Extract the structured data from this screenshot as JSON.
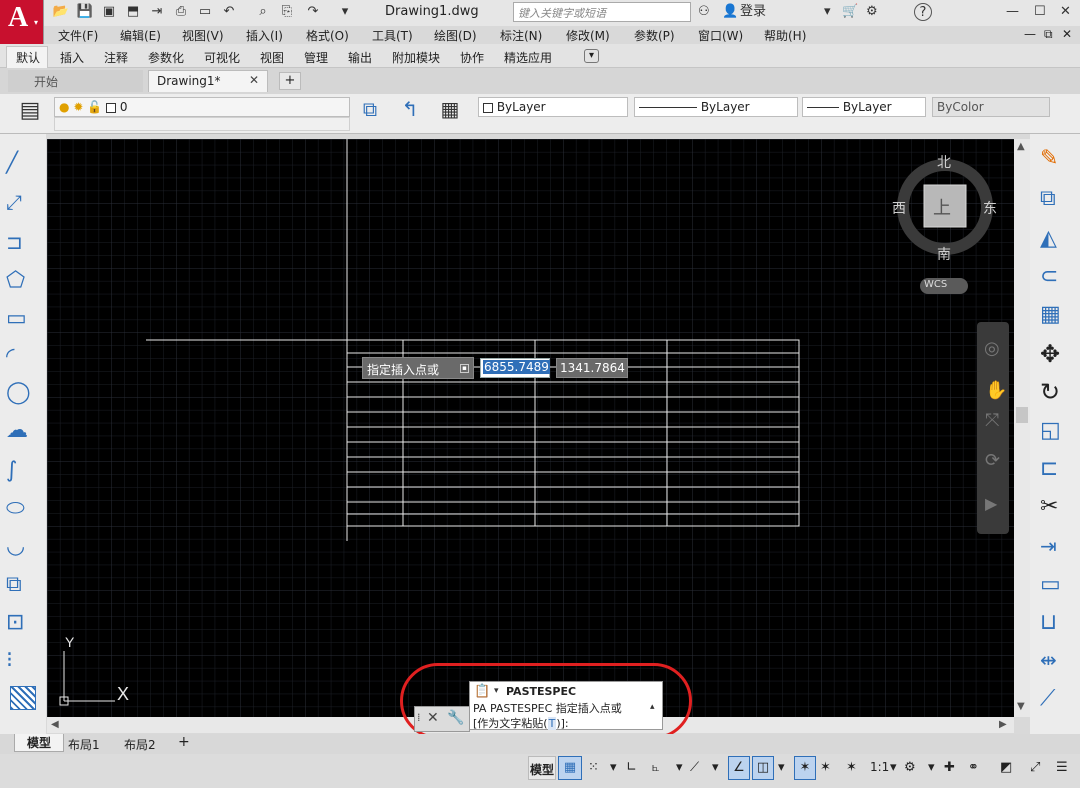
{
  "app": {
    "logo_letter": "A",
    "logo_sub": "▾",
    "title": "Drawing1.dwg"
  },
  "titlebar": {
    "search_placeholder": "键入关键字或短语",
    "login_label": "登录",
    "help_label": "?",
    "min_label": "—",
    "max_label": "☐",
    "close_label": "✕"
  },
  "menubar": {
    "items": [
      "文件(F)",
      "编辑(E)",
      "视图(V)",
      "插入(I)",
      "格式(O)",
      "工具(T)",
      "绘图(D)",
      "标注(N)",
      "修改(M)",
      "参数(P)",
      "窗口(W)",
      "帮助(H)"
    ],
    "win_min": "—",
    "win_restore": "⧉",
    "win_close": "✕"
  },
  "ribbon": {
    "tabs": [
      "默认",
      "插入",
      "注释",
      "参数化",
      "可视化",
      "视图",
      "管理",
      "输出",
      "附加模块",
      "协作",
      "精选应用"
    ]
  },
  "filetabs": {
    "start": "开始",
    "drawing": "Drawing1*",
    "close": "✕",
    "add": "+"
  },
  "properties": {
    "layer_value": "0",
    "color_value": "ByLayer",
    "linetype_value": "ByLayer",
    "lineweight_value": "ByLayer",
    "plotstyle_value": "ByColor"
  },
  "canvas": {
    "tooltip_label": "指定插入点或",
    "coord_x": "6855.7489",
    "coord_y": "1341.7864",
    "ucs_x": "X",
    "ucs_y": "Y"
  },
  "navcube": {
    "north": "北",
    "south": "南",
    "east": "东",
    "west": "西",
    "top": "上",
    "wcs": "WCS"
  },
  "command": {
    "cmd_name": "PASTESPEC",
    "line1": "PA  PASTESPEC 指定插入点或",
    "line2_open": "[作为文字粘贴(",
    "line2_key": "T",
    "line2_close": ")]:"
  },
  "layouttabs": {
    "model": "模型",
    "layout1": "布局1",
    "layout2": "布局2",
    "add": "+"
  },
  "statusbar": {
    "model": "模型",
    "scale": "1:1"
  },
  "colors": {
    "accent": "#2f6fb8",
    "logo": "#c8102e",
    "alert": "#e02020",
    "canvas": "#000000"
  }
}
